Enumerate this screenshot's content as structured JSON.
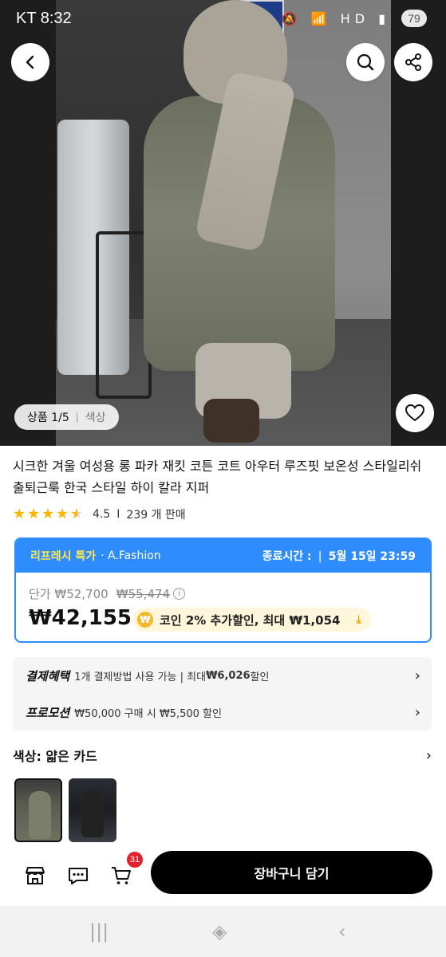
{
  "status_bar": {
    "carrier_time": "KT 8:32",
    "signal_icons": "🔕 📶 HD ▮",
    "battery": "79"
  },
  "gallery": {
    "index_label": "상품 1/5",
    "option_label": "색상"
  },
  "product": {
    "title": "시크한 겨울 여성용 롱 파카 재킷 코튼 코트 아우터 루즈핏 보온성 스타일리쉬 출퇴근룩 한국 스타일 하이 칼라 지퍼",
    "rating": "4.5",
    "rating_stars": 4.5,
    "sold": "239 개 판매"
  },
  "deal": {
    "deal_name": "리프레시 특가",
    "shop": "· A.Fashion",
    "end_label": "종료시간 :",
    "end_time": "5월 15일 23:59",
    "unit_label": "단가 ₩52,700",
    "original_price": "₩55,474",
    "sale_price": "₩42,155",
    "coin_text": "코인 2% 추가할인, 최대 ₩1,054"
  },
  "benefits": {
    "payment_label": "결제혜택",
    "payment_text": "1개 결제방법 사용 가능 | 최대 ",
    "payment_amount": "₩6,026",
    "payment_suffix": " 할인",
    "promo_label": "프로모션",
    "promo_text": "₩50,000 구매 시 ₩5,500 할인"
  },
  "color": {
    "label": "색상: 얇은 카드"
  },
  "bottom": {
    "cart_count": "31",
    "cta": "장바구니 담기"
  },
  "colors": {
    "accent_blue": "#2e8cff",
    "deal_yellow": "#ffe94a",
    "cta_black": "#000000",
    "badge_red": "#e3212d",
    "star": "#ffb400"
  }
}
